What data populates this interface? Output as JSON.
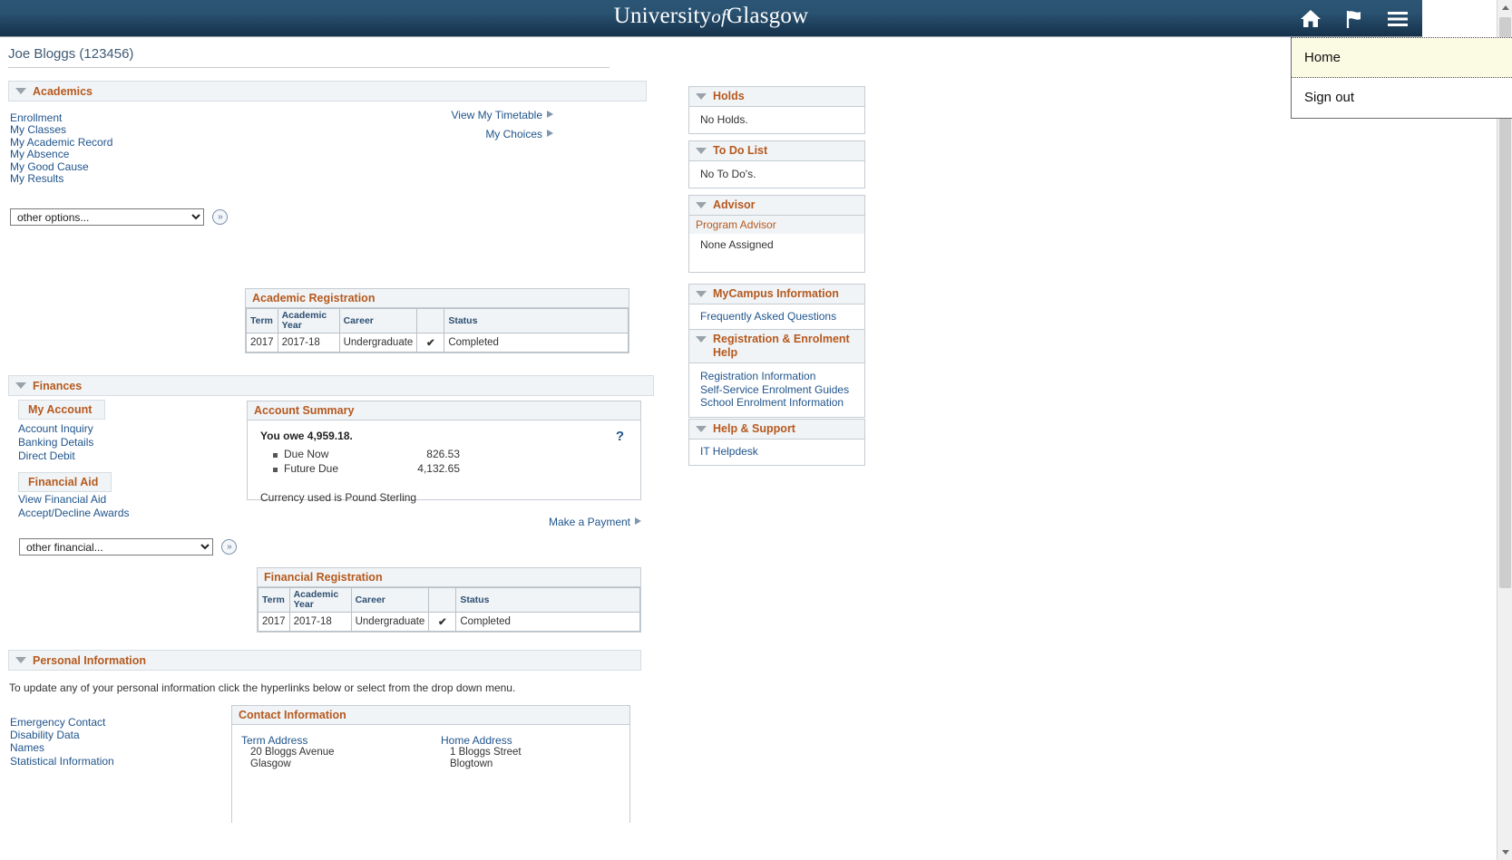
{
  "header": {
    "logo_university": "University",
    "logo_of": "of",
    "logo_glasgow": "Glasgow",
    "icons": [
      "home-icon",
      "flag-icon",
      "hamburger-menu-icon"
    ]
  },
  "nav_menu": {
    "items": [
      {
        "label": "Home",
        "active": true
      },
      {
        "label": "Sign out",
        "active": false
      }
    ]
  },
  "user": {
    "name_and_id": "Joe Bloggs (123456)"
  },
  "academics": {
    "title": "Academics",
    "links": [
      "Enrollment",
      "My Classes",
      "My Academic Record",
      "My Absence",
      "My Good Cause",
      "My Results"
    ],
    "right_links": [
      "View My Timetable",
      "My Choices"
    ],
    "select_value": "other options...",
    "go_label": "»",
    "registration": {
      "caption": "Academic Registration",
      "columns": [
        "Term",
        "Academic Year",
        "Career",
        "",
        "Status"
      ],
      "rows": [
        [
          "2017",
          "2017-18",
          "Undergraduate",
          "✔",
          "Completed"
        ]
      ]
    }
  },
  "finances": {
    "title": "Finances",
    "my_account_header": "My Account",
    "my_account_links": [
      "Account Inquiry",
      "Banking Details",
      "Direct Debit"
    ],
    "financial_aid_header": "Financial Aid",
    "financial_aid_links": [
      "View Financial Aid",
      "Accept/Decline Awards"
    ],
    "select_value": "other financial...",
    "go_label": "»",
    "account_summary": {
      "caption": "Account Summary",
      "owe_text": "You owe 4,959.18.",
      "help_icon": "?",
      "rows": [
        {
          "label": "Due Now",
          "amount": "826.53"
        },
        {
          "label": "Future Due",
          "amount": "4,132.65"
        }
      ],
      "currency_note": "Currency used is Pound Sterling"
    },
    "make_payment": "Make a Payment",
    "registration": {
      "caption": "Financial Registration",
      "columns": [
        "Term",
        "Academic Year",
        "Career",
        "",
        "Status"
      ],
      "rows": [
        [
          "2017",
          "2017-18",
          "Undergraduate",
          "✔",
          "Completed"
        ]
      ]
    }
  },
  "personal_information": {
    "title": "Personal Information",
    "note": "To update any of your personal information click the hyperlinks below or select from the drop down menu.",
    "links": [
      "Emergency Contact",
      "Disability Data",
      "Names",
      "Statistical Information"
    ],
    "contact_information": {
      "caption": "Contact Information",
      "addresses": [
        {
          "title": "Term Address",
          "lines": [
            "20 Bloggs Avenue",
            "Glasgow"
          ]
        },
        {
          "title": "Home Address",
          "lines": [
            "1 Bloggs Street",
            "Blogtown"
          ]
        }
      ]
    }
  },
  "right_rail": {
    "panels": [
      {
        "title": "Holds",
        "text": "No Holds."
      },
      {
        "title": "To Do List",
        "text": "No To Do's."
      },
      {
        "title": "Advisor",
        "subheader": "Program Advisor",
        "text": "None Assigned"
      },
      {
        "title": "MyCampus Information",
        "links": [
          "Frequently Asked Questions"
        ]
      },
      {
        "title": "Registration & Enrolment Help",
        "links": [
          "Registration Information",
          "Self-Service Enrolment Guides",
          "School Enrolment Information"
        ]
      },
      {
        "title": "Help & Support",
        "links": [
          "IT Helpdesk"
        ]
      }
    ]
  },
  "colors": {
    "header_blue": "#1d3d59",
    "accent_orange": "#b5591f",
    "link_blue": "#21558c",
    "check_green": "#3aa80e",
    "menu_highlight": "#fbfbe4"
  }
}
